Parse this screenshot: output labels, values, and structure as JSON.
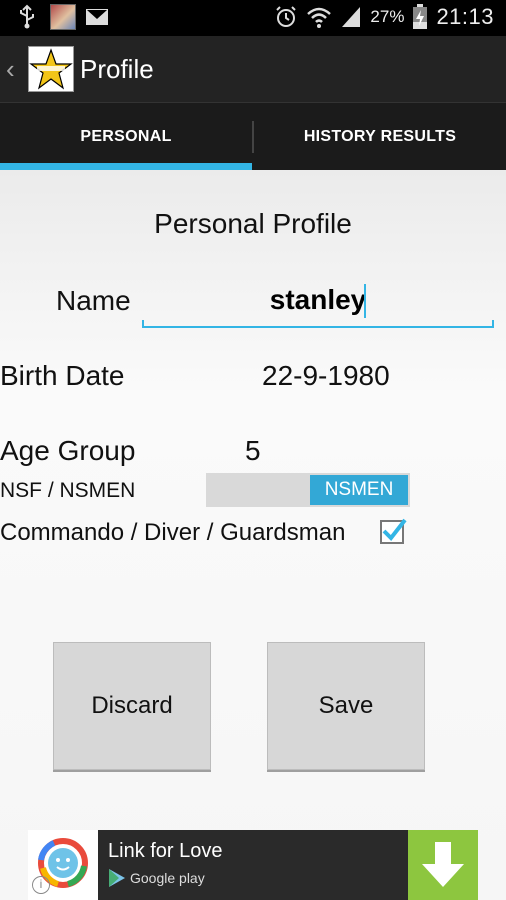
{
  "status_bar": {
    "battery_percent": "27%",
    "time": "21:13"
  },
  "action_bar": {
    "title": "Profile",
    "logo_icon": "star-logo-icon"
  },
  "tabs": [
    {
      "label": "PERSONAL",
      "selected": true
    },
    {
      "label": "HISTORY RESULTS",
      "selected": false
    }
  ],
  "form": {
    "heading": "Personal Profile",
    "name_label": "Name",
    "name_value": "stanley",
    "birth_label": "Birth Date",
    "birth_value": "22-9-1980",
    "age_label": "Age Group",
    "age_value": "5",
    "service_label": "NSF / NSMEN",
    "service_toggle_value": "NSMEN",
    "vocation_label": "Commando / Diver / Guardsman",
    "vocation_checked": true
  },
  "buttons": {
    "discard_label": "Discard",
    "save_label": "Save"
  },
  "ad": {
    "title": "Link for Love",
    "store": "Google play"
  },
  "colors": {
    "accent": "#33b5e5",
    "tab_bar": "#1b1b1b",
    "action_bar": "#232323",
    "download_green": "#8dc63f"
  }
}
